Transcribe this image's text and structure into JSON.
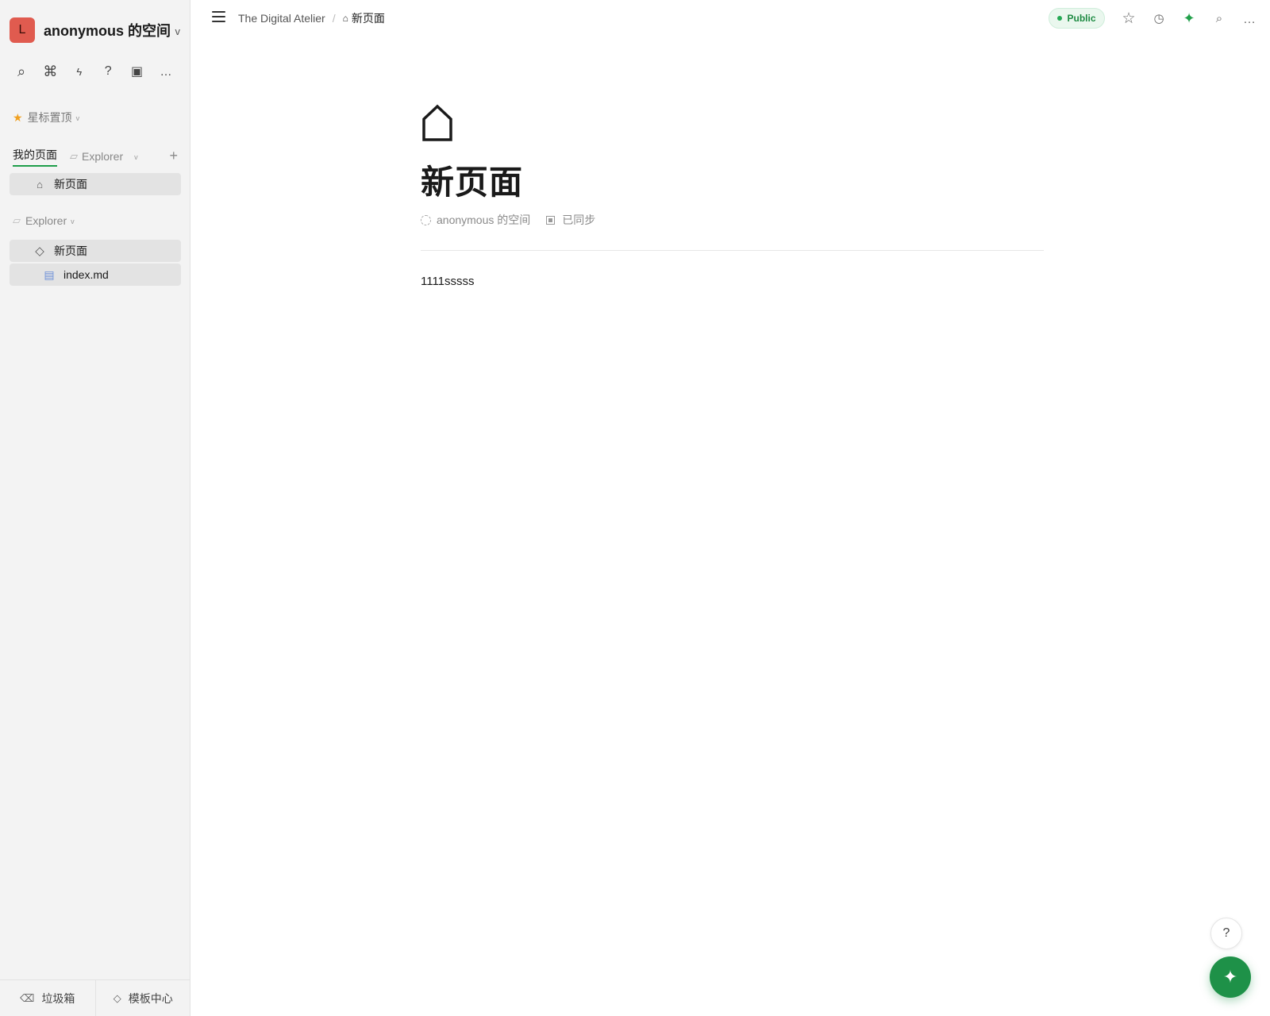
{
  "workspace": {
    "avatar_letter": "L",
    "name": "anonymous 的空间",
    "chevron": "v"
  },
  "toolbar": {
    "icons": [
      "search-icon",
      "command-icon",
      "lightning-icon",
      "help-icon",
      "sync-icon",
      "more-icon"
    ]
  },
  "sidebar": {
    "starred_label": "星标置顶",
    "tabs": {
      "mine": "我的页面",
      "explorer": "Explorer"
    },
    "my_pages": [
      {
        "label": "新页面",
        "icon": "home-icon"
      }
    ],
    "explorer_section": {
      "label": "Explorer",
      "items": [
        {
          "label": "新页面",
          "icon": "diamond-icon"
        },
        {
          "label": "index.md",
          "icon": "file-icon"
        }
      ]
    },
    "footer": {
      "trash": "垃圾箱",
      "templates": "模板中心"
    }
  },
  "topbar": {
    "breadcrumb_root": "The Digital Atelier",
    "breadcrumb_sep": "/",
    "breadcrumb_page": "新页面",
    "public_label": "Public"
  },
  "document": {
    "title": "新页面",
    "meta_space": "anonymous 的空间",
    "meta_sync": "已同步",
    "body_text": "1111sssss"
  },
  "fabs": {
    "help": "?"
  },
  "colors": {
    "accent_green": "#1e9148",
    "avatar_red": "#e05b4f",
    "star_orange": "#f0a020",
    "sidebar_bg": "#f3f3f3"
  }
}
